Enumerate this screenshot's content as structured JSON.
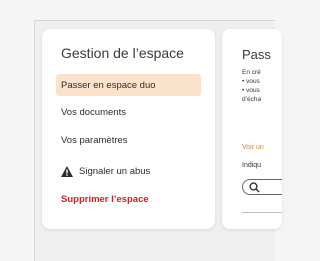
{
  "panel": {
    "title": "Gestion de l’espace",
    "items": [
      {
        "label": "Passer en espace duo",
        "active": true
      },
      {
        "label": "Vos documents"
      },
      {
        "label": "Vos paramètres"
      },
      {
        "label": "Signaler un abus",
        "icon": "warning-icon"
      },
      {
        "label": "Supprimer l’espace",
        "danger": true
      }
    ]
  },
  "right_panel": {
    "title": "Pass",
    "line1": "En cré",
    "line2": "• vous",
    "line3": "• vous",
    "line4": "d’écha",
    "link": "Voir un",
    "label": "Indiqu"
  },
  "colors": {
    "active_bg": "#fbe3cb",
    "danger": "#c8262c",
    "link": "#e08a2e"
  }
}
